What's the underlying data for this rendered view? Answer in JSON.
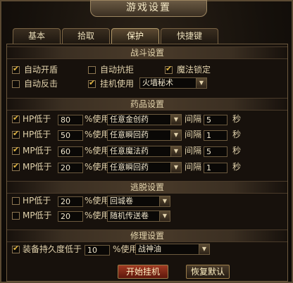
{
  "window": {
    "title": "游戏设置"
  },
  "tabs": [
    {
      "label": "基本"
    },
    {
      "label": "拾取"
    },
    {
      "label": "保护"
    },
    {
      "label": "快捷键"
    }
  ],
  "combat": {
    "header": "战斗设置",
    "auto_shield": {
      "label": "自动开盾",
      "checked": true
    },
    "auto_resist": {
      "label": "自动抗拒",
      "checked": false
    },
    "magic_lock": {
      "label": "魔法锁定",
      "checked": true
    },
    "auto_counter": {
      "label": "自动反击",
      "checked": false
    },
    "afk_use": {
      "label": "挂机使用",
      "checked": true,
      "skill": "火墙秘术"
    }
  },
  "potions": {
    "header": "药品设置",
    "rows": [
      {
        "label": "HP低于",
        "checked": true,
        "value": "80",
        "use_label": "%使用",
        "item": "任意金创药",
        "interval_label": "间隔",
        "interval": "5",
        "unit": "秒"
      },
      {
        "label": "HP低于",
        "checked": true,
        "value": "50",
        "use_label": "%使用",
        "item": "任意瞬回药",
        "interval_label": "间隔",
        "interval": "1",
        "unit": "秒"
      },
      {
        "label": "MP低于",
        "checked": true,
        "value": "60",
        "use_label": "%使用",
        "item": "任意魔法药",
        "interval_label": "间隔",
        "interval": "5",
        "unit": "秒"
      },
      {
        "label": "MP低于",
        "checked": true,
        "value": "20",
        "use_label": "%使用",
        "item": "任意瞬回药",
        "interval_label": "间隔",
        "interval": "1",
        "unit": "秒"
      }
    ]
  },
  "escape": {
    "header": "逃脱设置",
    "rows": [
      {
        "label": "HP低于",
        "checked": false,
        "value": "20",
        "use_label": "%使用",
        "item": "回城卷"
      },
      {
        "label": "MP低于",
        "checked": false,
        "value": "20",
        "use_label": "%使用",
        "item": "随机传送卷"
      }
    ]
  },
  "repair": {
    "header": "修理设置",
    "label": "装备持久度低于",
    "checked": true,
    "value": "10",
    "use_label": "%使用",
    "item": "战神油"
  },
  "buttons": {
    "start": "开始挂机",
    "reset": "恢复默认"
  }
}
